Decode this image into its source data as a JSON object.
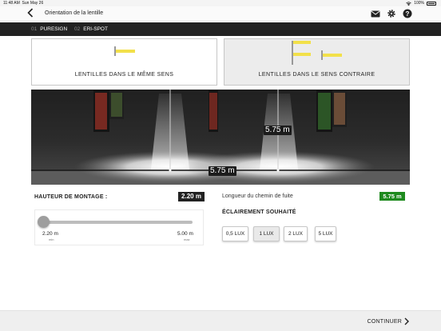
{
  "status": {
    "time": "11:48 AM",
    "date": "Sun May 26",
    "battery": "100%"
  },
  "nav": {
    "back_icon": "chevron-left-icon",
    "title": "Orientation de la lentille",
    "icons": [
      "mail-icon",
      "gear-icon",
      "help-icon"
    ]
  },
  "steps": [
    {
      "num": "01",
      "label": "PURESIGN"
    },
    {
      "num": "02",
      "label": "ERI-SPOT"
    }
  ],
  "options": [
    {
      "label": "LENTILLES DANS LE MÊME SENS",
      "selected": true
    },
    {
      "label": "LENTILLES DANS LE SENS CONTRAIRE",
      "selected": false
    }
  ],
  "scene": {
    "measure_vertical": "5.75 m",
    "measure_horizontal": "5.75 m"
  },
  "mounting": {
    "label": "HAUTEUR DE MONTAGE :",
    "value": "2.20 m",
    "min_value": "2.20 m",
    "min_label": "min",
    "max_value": "5.00 m",
    "max_label": "max",
    "slider_fraction": 0
  },
  "escape": {
    "label": "Longueur du chemin de fuite",
    "value": "5.75 m",
    "color": "#1e8a1e"
  },
  "illumination": {
    "label": "ÉCLAIREMENT SOUHAITÉ",
    "options": [
      "0,5 LUX",
      "1 LUX",
      "2 LUX",
      "5 LUX"
    ],
    "selected": "1 LUX"
  },
  "footer": {
    "continue_label": "CONTINUER"
  },
  "colors": {
    "accent_yellow": "#f2e04a",
    "dark": "#222222",
    "green": "#1e8a1e"
  }
}
